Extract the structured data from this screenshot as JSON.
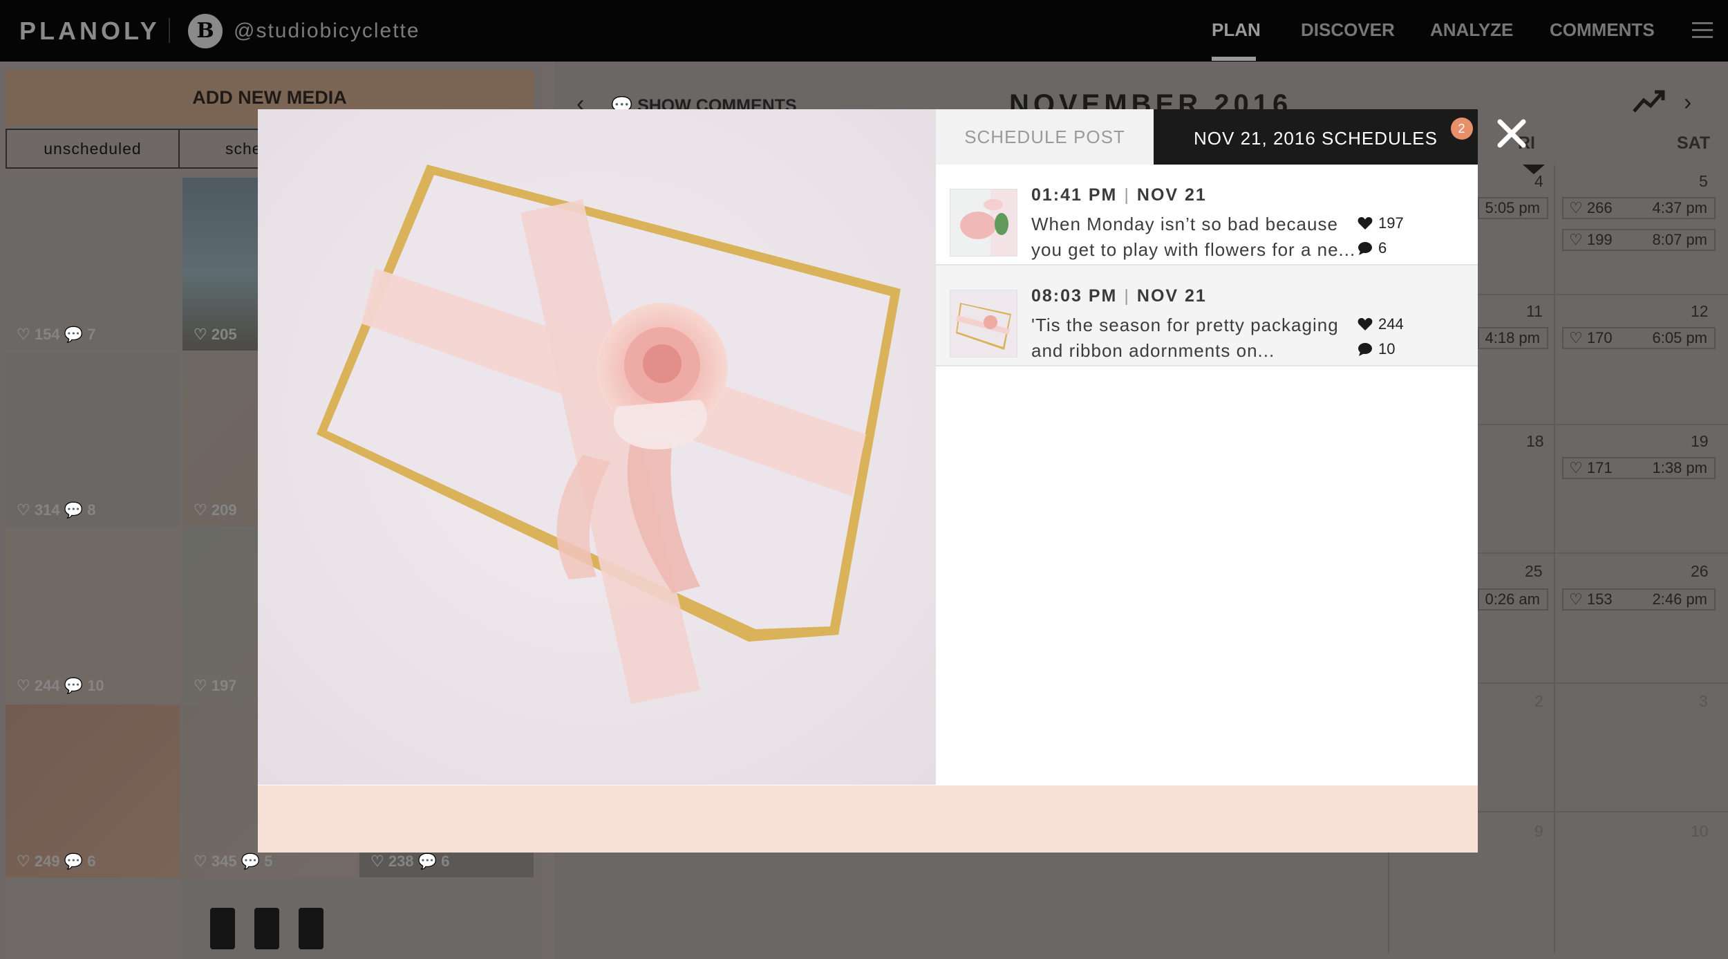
{
  "app": {
    "logo": "PLANOLY",
    "account_initial": "B",
    "account_handle": "@studiobicyclette",
    "nav": [
      "PLAN",
      "DISCOVER",
      "ANALYZE",
      "COMMENTS"
    ],
    "active_nav": "PLAN"
  },
  "media_panel": {
    "add_new_media": "ADD NEW MEDIA",
    "tabs": [
      "unscheduled",
      "sche"
    ],
    "tiles": [
      {
        "likes": "154",
        "comments": "7"
      },
      {
        "likes": "205",
        "comments": ""
      },
      {
        "likes": "",
        "comments": ""
      },
      {
        "likes": "314",
        "comments": "8"
      },
      {
        "likes": "209",
        "comments": ""
      },
      {
        "likes": "",
        "comments": ""
      },
      {
        "likes": "244",
        "comments": "10"
      },
      {
        "likes": "197",
        "comments": ""
      },
      {
        "likes": "",
        "comments": ""
      },
      {
        "likes": "249",
        "comments": "6"
      },
      {
        "likes": "345",
        "comments": "5"
      },
      {
        "likes": "238",
        "comments": "6"
      }
    ]
  },
  "calendar": {
    "show_comments": "SHOW COMMENTS",
    "month": "NOVEMBER 2016",
    "day_headers": [
      "RI",
      "SAT"
    ],
    "dates": {
      "fri": [
        "4",
        "11",
        "18",
        "25",
        "2",
        "9"
      ],
      "sat": [
        "5",
        "12",
        "19",
        "26",
        "3",
        "10"
      ]
    },
    "fri_posts": [
      "5:05 pm",
      "4:18 pm",
      "0:26 am"
    ],
    "sat_posts": [
      {
        "likes": "266",
        "time": "4:37 pm"
      },
      {
        "likes": "199",
        "time": "8:07 pm"
      },
      {
        "likes": "170",
        "time": "6:05 pm"
      },
      {
        "likes": "171",
        "time": "1:38 pm"
      },
      {
        "likes": "153",
        "time": "2:46 pm"
      }
    ]
  },
  "modal": {
    "tab_schedule_post": "SCHEDULE POST",
    "tab_schedules": "NOV 21, 2016 SCHEDULES",
    "schedule_count": "2",
    "close_symbol": "✕",
    "schedules": [
      {
        "time": "01:41 PM",
        "date": "NOV 21",
        "caption": "When Monday isn’t so bad because you get to play with flowers for a ne...",
        "likes": "197",
        "comments": "6"
      },
      {
        "time": "08:03 PM",
        "date": "NOV 21",
        "caption": "'Tis the season for pretty packaging and ribbon adornments on...",
        "likes": "244",
        "comments": "10"
      }
    ]
  }
}
